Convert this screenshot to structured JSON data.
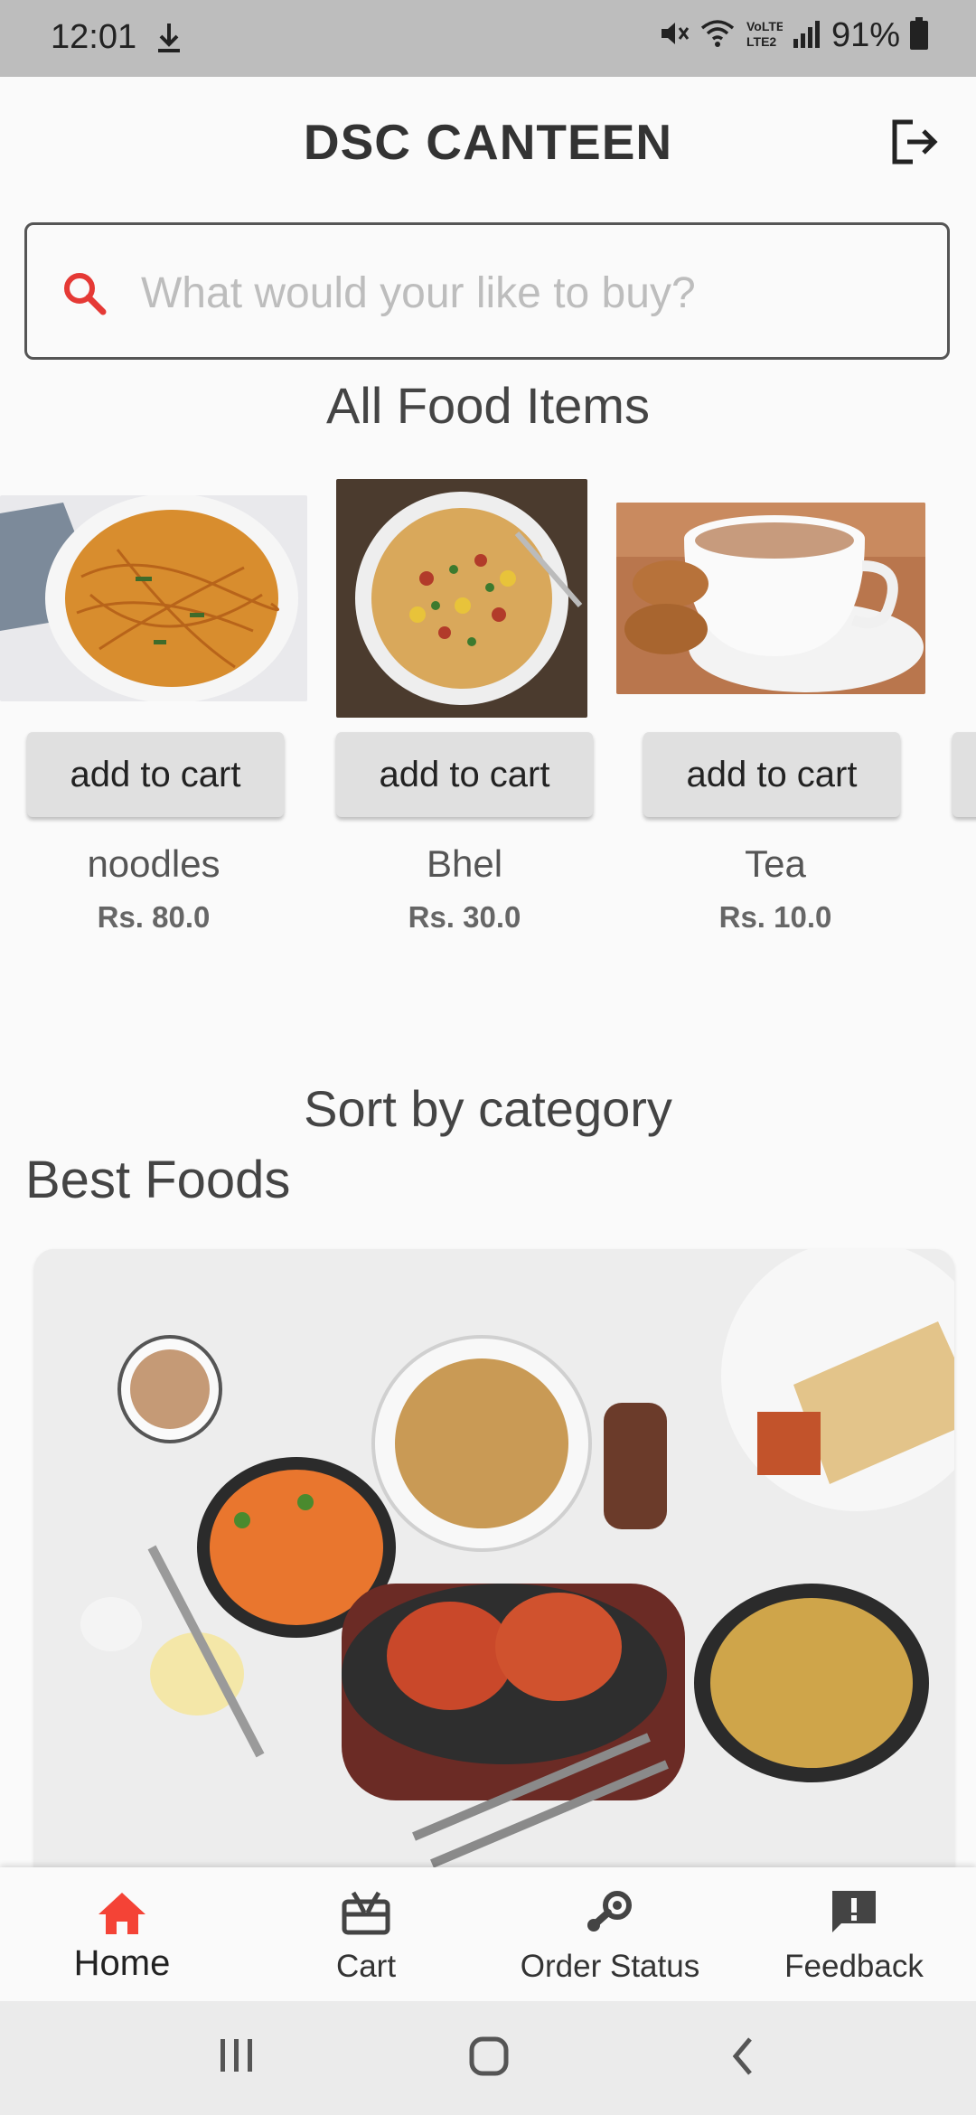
{
  "status_bar": {
    "time": "12:01",
    "battery": "91%"
  },
  "app_bar": {
    "title": "DSC CANTEEN"
  },
  "search": {
    "placeholder": "What would your like to buy?"
  },
  "sections": {
    "all_items": "All Food Items",
    "sort_by": "Sort by category",
    "best_foods": "Best Foods"
  },
  "food_items": [
    {
      "name": "noodles",
      "price": "Rs. 80.0",
      "button": "add to cart"
    },
    {
      "name": "Bhel",
      "price": "Rs. 30.0",
      "button": "add to cart"
    },
    {
      "name": "Tea",
      "price": "Rs. 10.0",
      "button": "add to cart"
    }
  ],
  "bottom_nav": {
    "items": [
      {
        "label": "Home",
        "icon": "home-icon",
        "active": true
      },
      {
        "label": "Cart",
        "icon": "cart-icon",
        "active": false
      },
      {
        "label": "Order Status",
        "icon": "order-status-icon",
        "active": false
      },
      {
        "label": "Feedback",
        "icon": "feedback-icon",
        "active": false
      }
    ]
  },
  "colors": {
    "accent": "#e53935",
    "text": "#333333",
    "button_bg": "#e0e0e0",
    "background": "#fafafa"
  }
}
